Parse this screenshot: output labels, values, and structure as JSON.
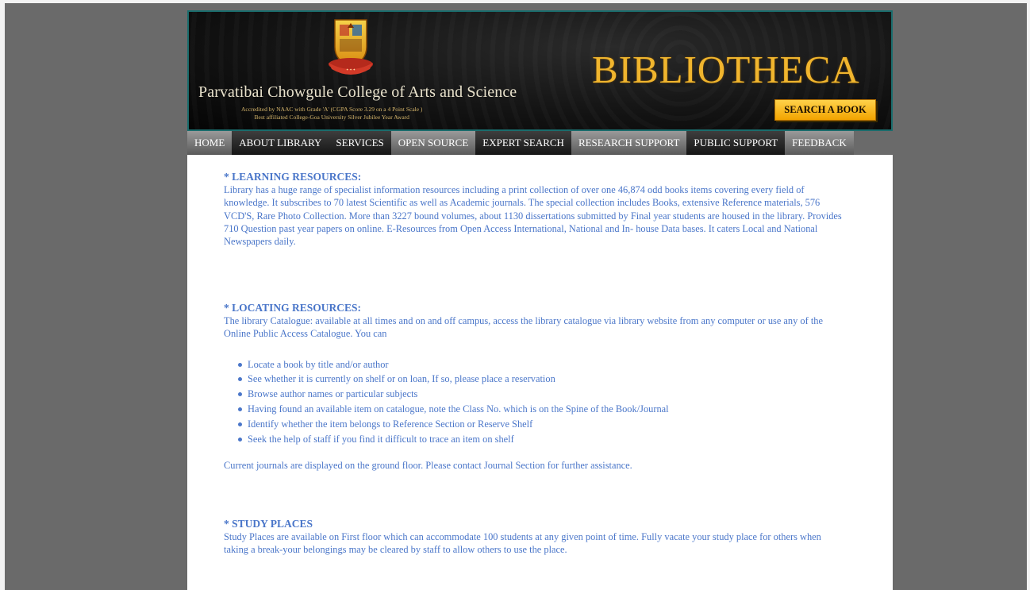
{
  "header": {
    "college_name": "Parvatibai Chowgule College of Arts and Science",
    "accreditation_line1": "Accredited by NAAC with Grade 'A' (CGPA Score 3.29 on a 4 Point Scale )",
    "accreditation_line2": "Best affiliated College-Goa University Silver Jubilee Year Award",
    "title": "BIBLIOTHECA",
    "search_button": "SEARCH A BOOK",
    "emblem_icon": "college-crest-icon"
  },
  "nav": {
    "items": [
      {
        "label": "HOME",
        "style": "light"
      },
      {
        "label": "ABOUT LIBRARY",
        "style": "dark"
      },
      {
        "label": "SERVICES",
        "style": "dark"
      },
      {
        "label": "OPEN SOURCE",
        "style": "light"
      },
      {
        "label": "EXPERT SEARCH",
        "style": "dark"
      },
      {
        "label": "RESEARCH SUPPORT",
        "style": "light"
      },
      {
        "label": "PUBLIC SUPPORT",
        "style": "dark"
      },
      {
        "label": "FEEDBACK",
        "style": "light"
      }
    ]
  },
  "colors": {
    "background": "#6a6a6a",
    "content_text": "#4a76c9",
    "banner_title": "#f0b52e",
    "banner_border": "#1a6c6c"
  },
  "sections": {
    "learning": {
      "heading": "* LEARNING RESOURCES:",
      "body": "Library has a huge range of specialist information resources including a print collection of over one 46,874 odd books items covering every field of knowledge. It subscribes to 70 latest Scientific as well as Academic journals. The special collection includes Books, extensive Reference materials, 576 VCD'S, Rare Photo Collection. More than 3227 bound volumes, about 1130 dissertations submitted by Final year students are housed in the library. Provides 710 Question past year papers on online. E-Resources from Open Access International, National and In- house Data bases. It caters Local and National Newspapers daily."
    },
    "locating": {
      "heading": "* LOCATING RESOURCES:",
      "intro": "The library Catalogue: available at all times and on and off campus, access the library catalogue via library website from any computer or use any of the Online Public Access Catalogue. You can",
      "bullets": [
        "Locate a book by title and/or author",
        "See whether it is currently on shelf or on loan, If so, please place a reservation",
        "Browse author names or particular subjects",
        "Having found an available item on catalogue, note the Class No. which is on the Spine of the Book/Journal",
        "Identify whether the item belongs to Reference Section  or Reserve Shelf",
        "Seek the help of staff if you find it difficult to trace an item on shelf"
      ],
      "footer": "Current journals are displayed on the ground floor. Please contact Journal Section for further assistance."
    },
    "study": {
      "heading": "* STUDY PLACES",
      "body": "Study Places are available on First floor which can accommodate 100 students at any given point of time. Fully vacate your study place for others when taking a break-your belongings may be cleared by staff to allow others to use the place."
    }
  }
}
